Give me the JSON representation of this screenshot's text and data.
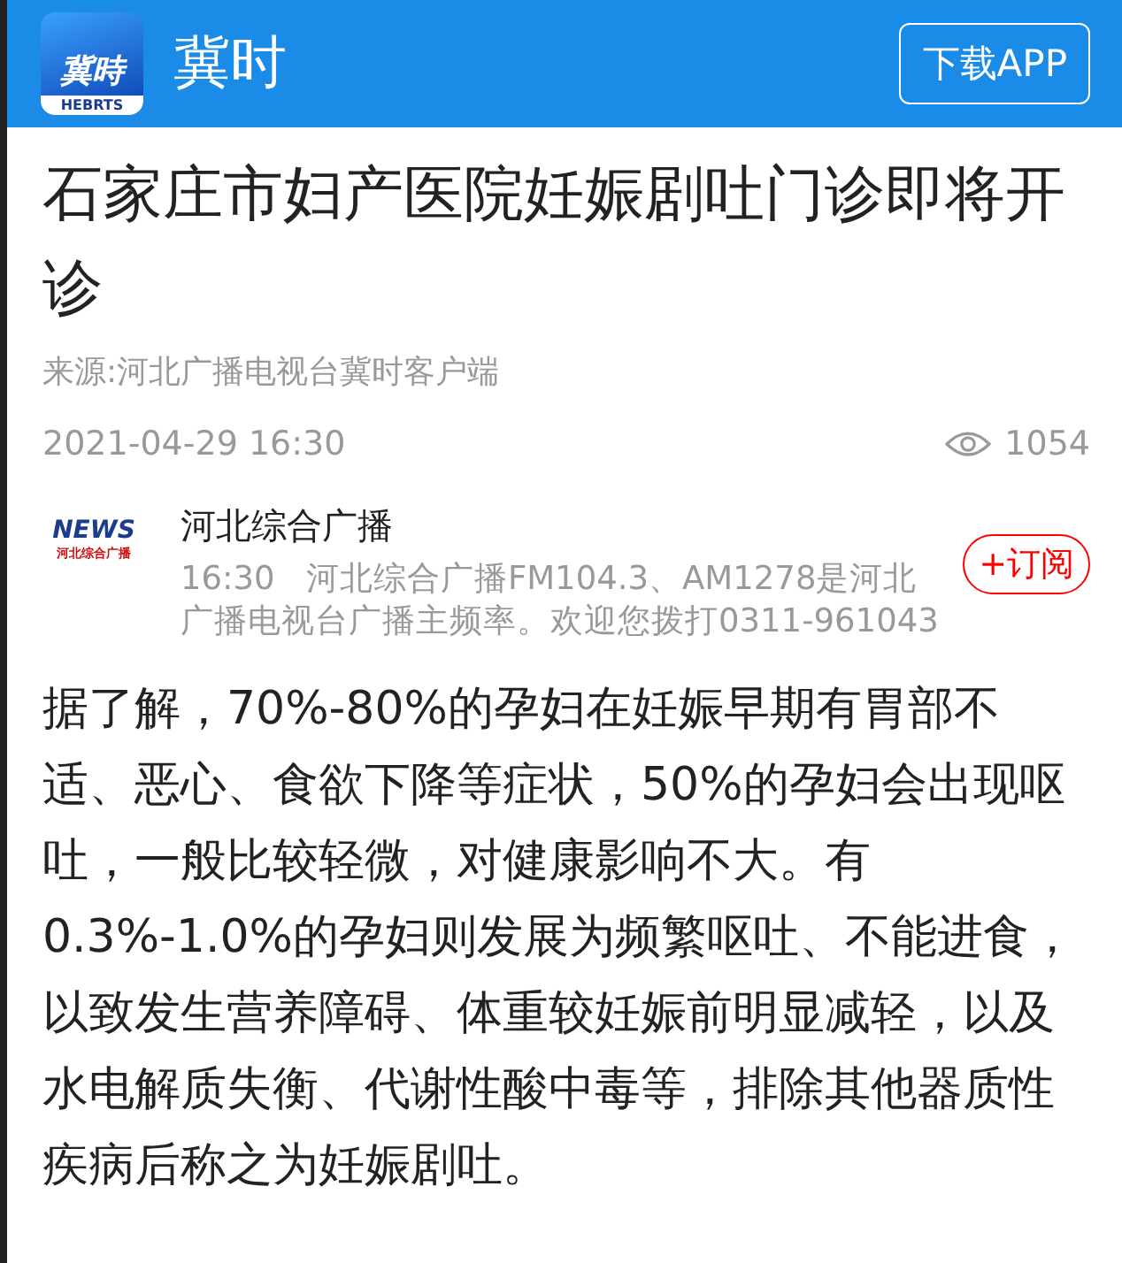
{
  "header": {
    "logo": {
      "glyphs": "冀時",
      "caption": "HEBRTS"
    },
    "app_name": "冀时",
    "download_button": "下载APP"
  },
  "article": {
    "title": "石家庄市妇产医院妊娠剧吐门诊即将开诊",
    "source": "来源:河北广播电视台冀时客户端",
    "date": "2021-04-29 16:30",
    "views": "1054"
  },
  "channel": {
    "logo": {
      "wordmark": "NEWS",
      "caption": "河北综合广播"
    },
    "name": "河北综合广播",
    "time": "16:30",
    "description": "河北综合广播FM104.3、AM1278是河北广播电视台广播主频率。欢迎您拨打0311-961043",
    "subscribe_button": "+订阅"
  },
  "body": "据了解，70%-80%的孕妇在妊娠早期有胃部不适、恶心、食欲下降等症状，50%的孕妇会出现呕吐，一般比较轻微，对健康影响不大。有0.3%-1.0%的孕妇则发展为频繁呕吐、不能进食，以致发生营养障碍、体重较妊娠前明显减轻，以及水电解质失衡、代谢性酸中毒等，排除其他器质性疾病后称之为妊娠剧吐。"
}
